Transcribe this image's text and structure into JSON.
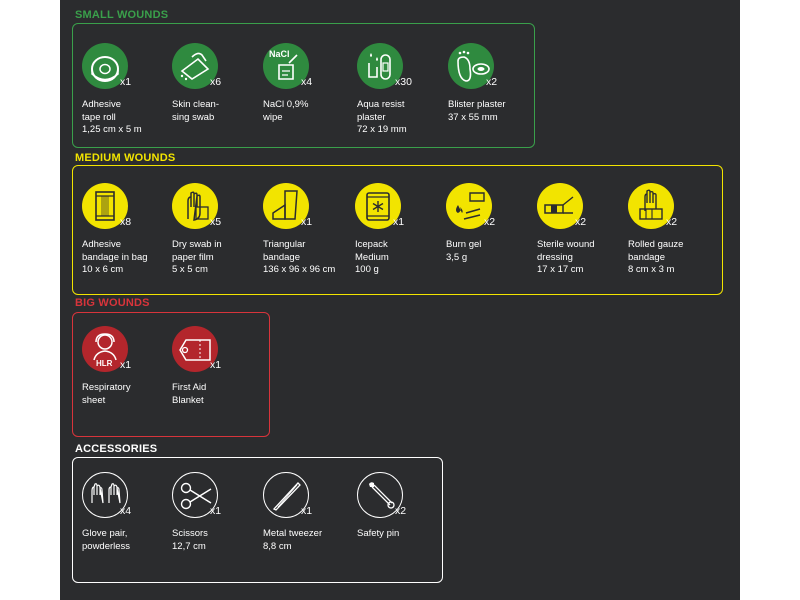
{
  "colors": {
    "small": "#2f8a3f",
    "medium": "#f2e400",
    "big": "#c8262e",
    "accessories": "#ffffff",
    "panel": "#2b2c2e"
  },
  "sections": {
    "small": {
      "title": "SMALL WOUNDS",
      "items": [
        {
          "icon": "tape-roll-icon",
          "qty": "x1",
          "label": "Adhesive\ntape roll\n1,25 cm x 5 m"
        },
        {
          "icon": "cleansing-swab-icon",
          "qty": "x6",
          "label": "Skin clean-\nsing swab"
        },
        {
          "icon": "nacl-wipe-icon",
          "qty": "x4",
          "label": "NaCl 0,9%\nwipe",
          "badge": "NaCl"
        },
        {
          "icon": "aqua-plaster-icon",
          "qty": "x30",
          "label": "Aqua resist\nplaster\n72 x 19 mm"
        },
        {
          "icon": "blister-plaster-icon",
          "qty": "x2",
          "label": "Blister plaster\n37 x 55 mm"
        }
      ]
    },
    "medium": {
      "title": "MEDIUM WOUNDS",
      "items": [
        {
          "icon": "bandage-bag-icon",
          "qty": "x8",
          "label": "Adhesive\nbandage in bag\n10 x 6 cm"
        },
        {
          "icon": "dry-swab-icon",
          "qty": "x5",
          "label": "Dry swab in\npaper film\n5 x 5 cm"
        },
        {
          "icon": "triangular-bandage-icon",
          "qty": "x1",
          "label": "Triangular\nbandage\n136 x 96 x 96 cm"
        },
        {
          "icon": "icepack-icon",
          "qty": "x1",
          "label": "Icepack\nMedium\n100 g"
        },
        {
          "icon": "burn-gel-icon",
          "qty": "x2",
          "label": "Burn gel\n3,5 g"
        },
        {
          "icon": "wound-dressing-icon",
          "qty": "x2",
          "label": "Sterile wound\ndressing\n17 x 17 cm"
        },
        {
          "icon": "gauze-bandage-icon",
          "qty": "x2",
          "label": "Rolled gauze\nbandage\n8 cm x 3 m"
        }
      ]
    },
    "big": {
      "title": "BIG WOUNDS",
      "items": [
        {
          "icon": "respiratory-sheet-icon",
          "qty": "x1",
          "label": "Respiratory\nsheet",
          "badge": "HLR"
        },
        {
          "icon": "blanket-icon",
          "qty": "x1",
          "label": "First Aid\nBlanket"
        }
      ]
    },
    "accessories": {
      "title": "ACCESSORIES",
      "items": [
        {
          "icon": "gloves-icon",
          "qty": "x4",
          "label": "Glove pair,\npowderless"
        },
        {
          "icon": "scissors-icon",
          "qty": "x1",
          "label": "Scissors\n12,7 cm"
        },
        {
          "icon": "tweezer-icon",
          "qty": "x1",
          "label": "Metal tweezer\n8,8 cm"
        },
        {
          "icon": "safety-pin-icon",
          "qty": "x2",
          "label": "Safety pin"
        }
      ]
    }
  }
}
